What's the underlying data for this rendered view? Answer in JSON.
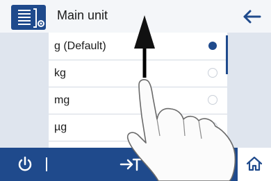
{
  "header": {
    "title": "Main unit",
    "settings_icon": "settings-list-icon",
    "back_icon": "arrow-left-icon"
  },
  "list": {
    "items": [
      {
        "label": "g (Default)",
        "selected": true
      },
      {
        "label": "kg",
        "selected": false
      },
      {
        "label": "mg",
        "selected": false
      },
      {
        "label": "µg",
        "selected": false
      }
    ]
  },
  "footer": {
    "power_icon": "power-icon",
    "zero_icon": "zero-arrow-icon",
    "home_icon": "home-icon"
  },
  "colors": {
    "accent": "#1f4a8c",
    "side_panel": "#dfe5ee",
    "header_bg": "#f4f6f9"
  }
}
